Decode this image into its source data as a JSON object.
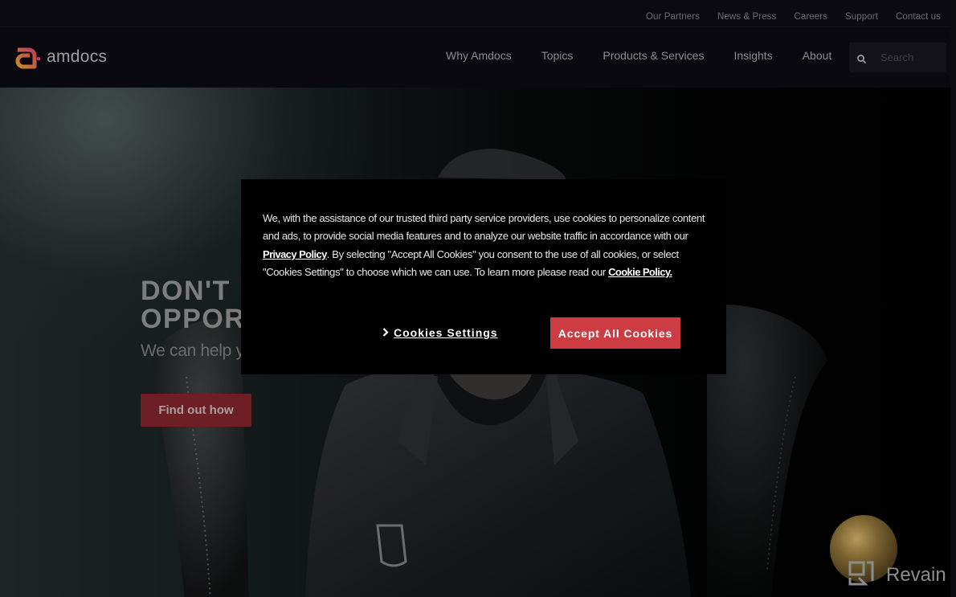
{
  "utility_nav": {
    "items": [
      "Our Partners",
      "News & Press",
      "Careers",
      "Support",
      "Contact us"
    ]
  },
  "brand": {
    "name": "amdocs",
    "logo_icon": "amdocs-a-logo",
    "accent": "#cc3c42"
  },
  "main_nav": {
    "items": [
      "Why Amdocs",
      "Topics",
      "Products & Services",
      "Insights",
      "About"
    ],
    "search": {
      "icon": "search-icon",
      "placeholder": "Search"
    }
  },
  "hero": {
    "title_line1": "DON'T MISS",
    "title_line2": "OPPORTUNITY",
    "title_visible_line1": "DON'T I",
    "title_visible_line2": "OPPOR",
    "subtitle": "We can help yo",
    "cta_label": "Find out how",
    "cta_color": "#6e1f24"
  },
  "cookie_banner": {
    "text_part1": "We, with the assistance of our trusted third party service providers, use cookies to personalize content and ads, to provide social media features and to analyze our website traffic in accordance with our ",
    "privacy_link": "Privacy Policy",
    "text_part2": ". By selecting \"Accept All Cookies\" you consent to the use of all cookies, or select \"Cookies Settings\" to choose which we can use. To learn more please read our ",
    "cookie_link": "Cookie Policy.",
    "settings_chevron": "›",
    "settings_label": "Cookies Settings",
    "accept_label": "Accept All Cookies"
  },
  "watermark": {
    "text": "Revain"
  }
}
